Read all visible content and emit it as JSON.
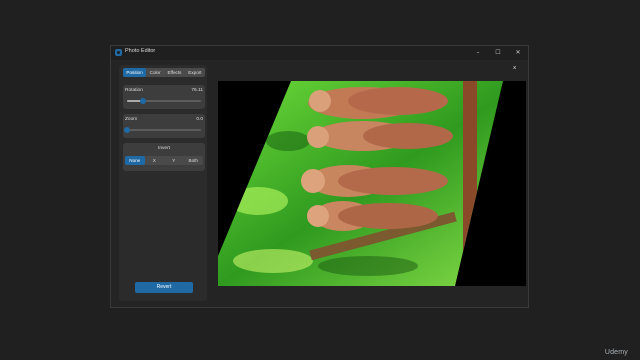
{
  "window": {
    "title": "Photo Editor",
    "minimize": "–",
    "maximize": "☐",
    "close": "✕"
  },
  "tabs": [
    {
      "label": "Position",
      "active": true
    },
    {
      "label": "Color",
      "active": false
    },
    {
      "label": "Effects",
      "active": false
    },
    {
      "label": "Export",
      "active": false
    }
  ],
  "rotation": {
    "label": "Rotation",
    "value": "76.11",
    "fraction": 0.21
  },
  "zoom": {
    "label": "Zoom",
    "value": "0.0",
    "fraction": 0.0
  },
  "invert": {
    "label": "Invert",
    "options": [
      {
        "label": "None",
        "active": true
      },
      {
        "label": "X",
        "active": false
      },
      {
        "label": "Y",
        "active": false
      },
      {
        "label": "Both",
        "active": false
      }
    ]
  },
  "revert_label": "Revert",
  "image_close": "x",
  "image_description_icon": "otters-photo",
  "watermark": "Udemy",
  "colors": {
    "accent": "#1f6aa5",
    "background": "#242424",
    "panel": "#2b2b2b",
    "card": "#3d3d3d"
  }
}
